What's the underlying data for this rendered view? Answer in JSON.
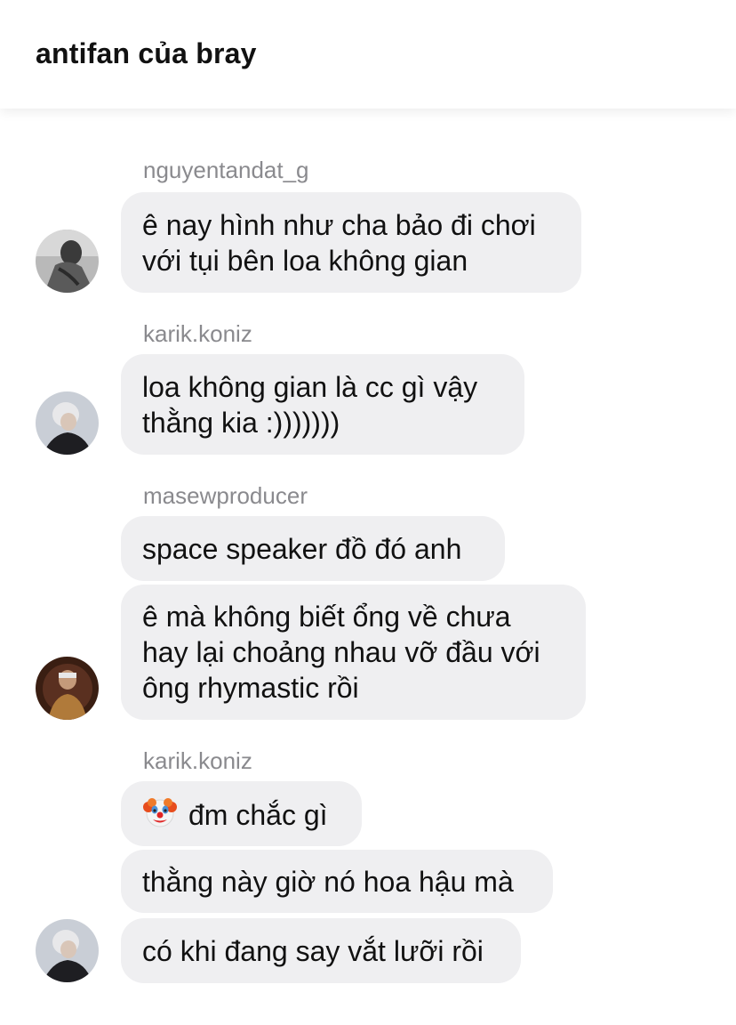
{
  "header": {
    "title": "antifan của bray"
  },
  "messages": {
    "g1": {
      "sender": "nguyentandat_g",
      "b1": [
        "ê nay hình như cha bảo đi chơi",
        "với tụi bên loa không gian"
      ]
    },
    "g2": {
      "sender": "karik.koniz",
      "b1": [
        "loa không gian là cc gì vậy",
        "thằng kia :)))))))"
      ]
    },
    "g3": {
      "sender": "masewproducer",
      "b1": "space speaker đồ đó anh",
      "b2": [
        "ê mà không biết ổng về chưa",
        "hay lại choảng nhau vỡ đầu với",
        "ông rhymastic rồi"
      ]
    },
    "g4": {
      "sender": "karik.koniz",
      "b1_icon": "clown-face-emoji",
      "b1": "đm chắc gì",
      "b2": "thằng này giờ nó hoa hậu mà",
      "b3": "có khi đang say vắt lưỡi rồi"
    }
  },
  "colors": {
    "bubble_bg": "#efeff1",
    "sender_text": "#8a8a8e",
    "message_text": "#111111",
    "background": "#ffffff"
  }
}
